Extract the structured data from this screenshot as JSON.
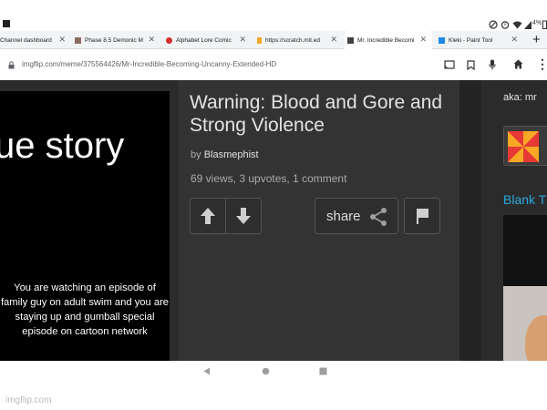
{
  "status_bar": {
    "battery": "4%",
    "icons": [
      "do-not-disturb-icon",
      "alarm-icon",
      "wifi-icon",
      "signal-icon",
      "battery-icon"
    ]
  },
  "tabs": [
    {
      "label": "Channel dashboard -",
      "icon": "youtube-studio-favicon",
      "color": "#ffffff"
    },
    {
      "label": "Phase 8.5 Demonic M",
      "icon": "page-favicon",
      "color": "#8d6e63"
    },
    {
      "label": "Alphabet Lore Comic",
      "icon": "comic-favicon",
      "color": "#d32f2f"
    },
    {
      "label": "https://scratch.mit.ed",
      "icon": "scratch-favicon",
      "color": "#f9a825"
    },
    {
      "label": "Mr. Incredible Becomi",
      "icon": "imgflip-favicon",
      "color": "#424242",
      "active": true
    },
    {
      "label": "Kleki - Paint Tool",
      "icon": "kleki-favicon",
      "color": "#1e88e5"
    }
  ],
  "address_bar": {
    "url": "imgflip.com/meme/375564426/Mr-Incredible-Becoming-Uncanny-Extended-HD"
  },
  "meme": {
    "title_text": "ue story",
    "caption": "You are watching an episode of family guy on adult swim and you are staying up and gumball special episode on cartoon network"
  },
  "post": {
    "title": "Warning: Blood and Gore and Strong Violence",
    "by_label": "by",
    "author": "Blasmephist",
    "stats": "69 views, 3 upvotes, 1 comment",
    "share_label": "share"
  },
  "sidebar": {
    "aka_text": "aka: mr",
    "blank_link": "Blank T"
  },
  "watermark": "imgflip.com",
  "colors": {
    "page_bg": "#2b2b2b",
    "link": "#29a9e0",
    "title_text": "#e3e3e3"
  }
}
